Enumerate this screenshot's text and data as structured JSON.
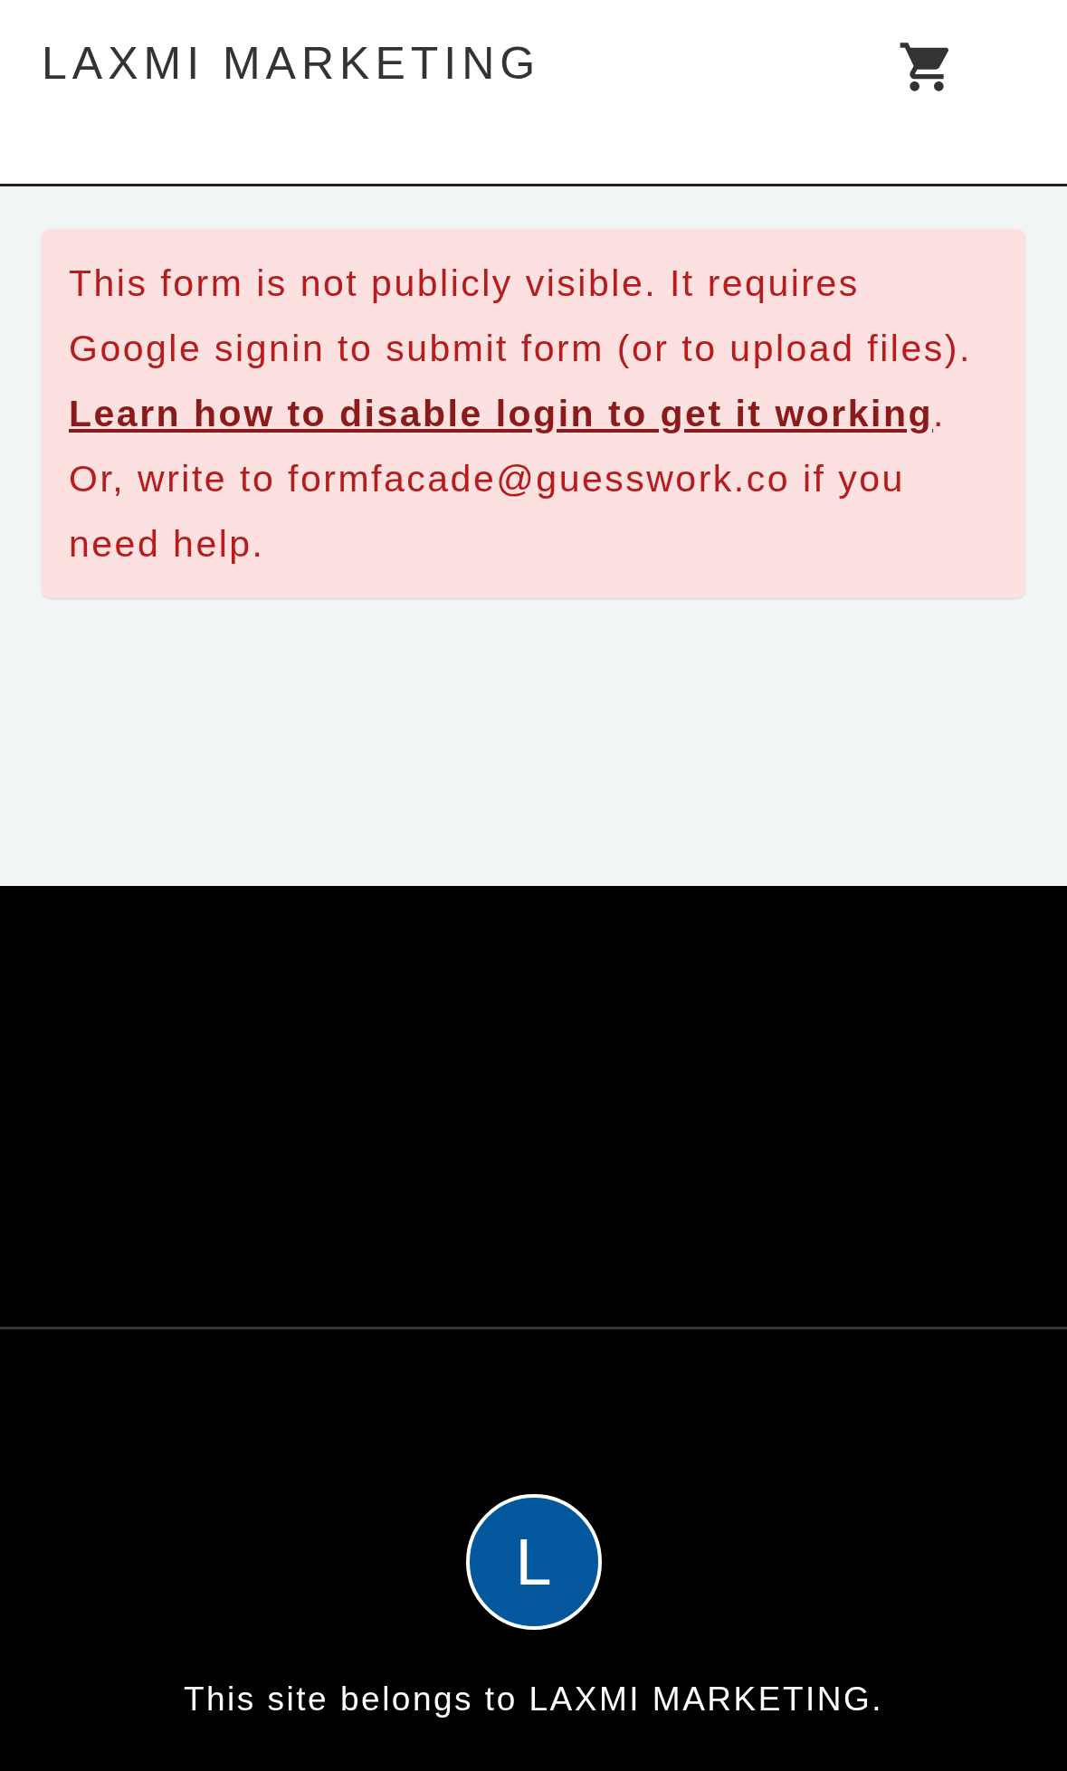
{
  "header": {
    "title": "LAXMI MARKETING"
  },
  "alert": {
    "text_before": "This form is not publicly visible. It requires Google signin to submit form (or to upload files). ",
    "link": "Learn how to disable login to get it working",
    "text_after": ". Or, write to formfacade@guesswork.co if you need help."
  },
  "footer": {
    "avatar_letter": "L",
    "owner_text": "This site belongs to LAXMI MARKETING."
  }
}
